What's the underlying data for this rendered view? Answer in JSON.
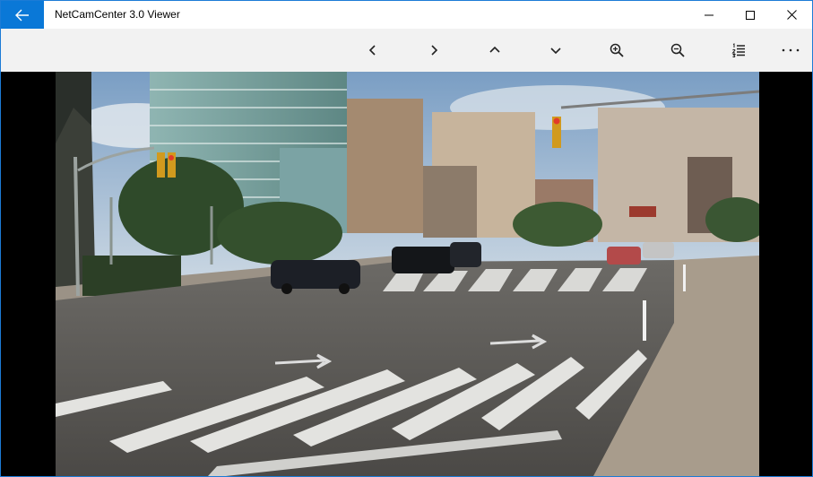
{
  "window": {
    "title": "NetCamCenter 3.0 Viewer",
    "accent": "#0a78d7"
  },
  "titlebar": {
    "back_icon": "arrow-left-icon",
    "controls": [
      "minimize-icon",
      "maximize-icon",
      "close-icon"
    ]
  },
  "toolbar": {
    "buttons": [
      {
        "name": "previous-button",
        "icon": "chevron-left-icon"
      },
      {
        "name": "next-button",
        "icon": "chevron-right-icon"
      },
      {
        "name": "up-button",
        "icon": "chevron-up-icon"
      },
      {
        "name": "down-button",
        "icon": "chevron-down-icon"
      },
      {
        "name": "zoom-in-button",
        "icon": "zoom-in-icon"
      },
      {
        "name": "zoom-out-button",
        "icon": "zoom-out-icon"
      },
      {
        "name": "list-button",
        "icon": "numbered-list-icon"
      },
      {
        "name": "more-button",
        "icon": "more-icon"
      }
    ]
  },
  "image": {
    "subject": "camera-feed-image"
  }
}
